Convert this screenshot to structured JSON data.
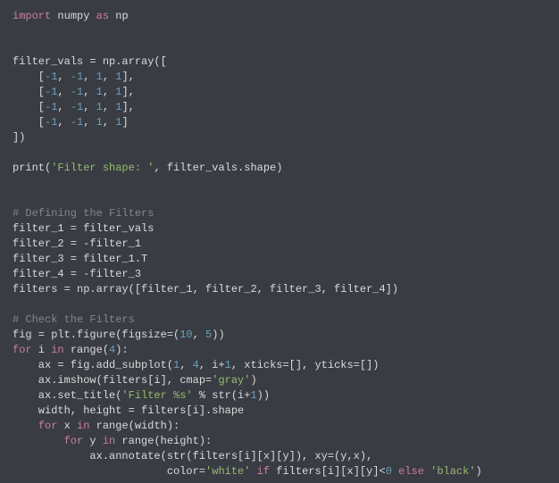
{
  "code": {
    "lines": [
      [
        {
          "t": "import",
          "c": "kw"
        },
        {
          "t": " numpy ",
          "c": "id"
        },
        {
          "t": "as",
          "c": "kw"
        },
        {
          "t": " np",
          "c": "id"
        }
      ],
      [],
      [],
      [
        {
          "t": "filter_vals = np.array([",
          "c": "id"
        }
      ],
      [
        {
          "t": "    [",
          "c": "id"
        },
        {
          "t": "-1",
          "c": "num"
        },
        {
          "t": ", ",
          "c": "id"
        },
        {
          "t": "-1",
          "c": "num"
        },
        {
          "t": ", ",
          "c": "id"
        },
        {
          "t": "1",
          "c": "num"
        },
        {
          "t": ", ",
          "c": "id"
        },
        {
          "t": "1",
          "c": "num"
        },
        {
          "t": "],",
          "c": "id"
        }
      ],
      [
        {
          "t": "    [",
          "c": "id"
        },
        {
          "t": "-1",
          "c": "num"
        },
        {
          "t": ", ",
          "c": "id"
        },
        {
          "t": "-1",
          "c": "num"
        },
        {
          "t": ", ",
          "c": "id"
        },
        {
          "t": "1",
          "c": "num"
        },
        {
          "t": ", ",
          "c": "id"
        },
        {
          "t": "1",
          "c": "num"
        },
        {
          "t": "],",
          "c": "id"
        }
      ],
      [
        {
          "t": "    [",
          "c": "id"
        },
        {
          "t": "-1",
          "c": "num"
        },
        {
          "t": ", ",
          "c": "id"
        },
        {
          "t": "-1",
          "c": "num"
        },
        {
          "t": ", ",
          "c": "id"
        },
        {
          "t": "1",
          "c": "num"
        },
        {
          "t": ", ",
          "c": "id"
        },
        {
          "t": "1",
          "c": "num"
        },
        {
          "t": "],",
          "c": "id"
        }
      ],
      [
        {
          "t": "    [",
          "c": "id"
        },
        {
          "t": "-1",
          "c": "num"
        },
        {
          "t": ", ",
          "c": "id"
        },
        {
          "t": "-1",
          "c": "num"
        },
        {
          "t": ", ",
          "c": "id"
        },
        {
          "t": "1",
          "c": "num"
        },
        {
          "t": ", ",
          "c": "id"
        },
        {
          "t": "1",
          "c": "num"
        },
        {
          "t": "]",
          "c": "id"
        }
      ],
      [
        {
          "t": "])",
          "c": "id"
        }
      ],
      [],
      [
        {
          "t": "print(",
          "c": "id"
        },
        {
          "t": "'Filter shape: '",
          "c": "str"
        },
        {
          "t": ", filter_vals.shape)",
          "c": "id"
        }
      ],
      [],
      [],
      [
        {
          "t": "# Defining the Filters",
          "c": "cmt"
        }
      ],
      [
        {
          "t": "filter_1 = filter_vals",
          "c": "id"
        }
      ],
      [
        {
          "t": "filter_2 = -filter_1",
          "c": "id"
        }
      ],
      [
        {
          "t": "filter_3 = filter_1.T",
          "c": "id"
        }
      ],
      [
        {
          "t": "filter_4 = -filter_3",
          "c": "id"
        }
      ],
      [
        {
          "t": "filters = np.array([filter_1, filter_2, filter_3, filter_4])",
          "c": "id"
        }
      ],
      [],
      [
        {
          "t": "# Check the Filters",
          "c": "cmt"
        }
      ],
      [
        {
          "t": "fig = plt.figure(figsize=(",
          "c": "id"
        },
        {
          "t": "10",
          "c": "num"
        },
        {
          "t": ", ",
          "c": "id"
        },
        {
          "t": "5",
          "c": "num"
        },
        {
          "t": "))",
          "c": "id"
        }
      ],
      [
        {
          "t": "for",
          "c": "kw"
        },
        {
          "t": " i ",
          "c": "id"
        },
        {
          "t": "in",
          "c": "kw"
        },
        {
          "t": " range(",
          "c": "id"
        },
        {
          "t": "4",
          "c": "num"
        },
        {
          "t": "):",
          "c": "id"
        }
      ],
      [
        {
          "t": "    ax = fig.add_subplot(",
          "c": "id"
        },
        {
          "t": "1",
          "c": "num"
        },
        {
          "t": ", ",
          "c": "id"
        },
        {
          "t": "4",
          "c": "num"
        },
        {
          "t": ", i+",
          "c": "id"
        },
        {
          "t": "1",
          "c": "num"
        },
        {
          "t": ", xticks=[], yticks=[])",
          "c": "id"
        }
      ],
      [
        {
          "t": "    ax.imshow(filters[i], cmap=",
          "c": "id"
        },
        {
          "t": "'gray'",
          "c": "str"
        },
        {
          "t": ")",
          "c": "id"
        }
      ],
      [
        {
          "t": "    ax.set_title(",
          "c": "id"
        },
        {
          "t": "'Filter %s'",
          "c": "str"
        },
        {
          "t": " % str(i+",
          "c": "id"
        },
        {
          "t": "1",
          "c": "num"
        },
        {
          "t": "))",
          "c": "id"
        }
      ],
      [
        {
          "t": "    width, height = filters[i].shape",
          "c": "id"
        }
      ],
      [
        {
          "t": "    ",
          "c": "id"
        },
        {
          "t": "for",
          "c": "kw"
        },
        {
          "t": " x ",
          "c": "id"
        },
        {
          "t": "in",
          "c": "kw"
        },
        {
          "t": " range(width):",
          "c": "id"
        }
      ],
      [
        {
          "t": "        ",
          "c": "id"
        },
        {
          "t": "for",
          "c": "kw"
        },
        {
          "t": " y ",
          "c": "id"
        },
        {
          "t": "in",
          "c": "kw"
        },
        {
          "t": " range(height):",
          "c": "id"
        }
      ],
      [
        {
          "t": "            ax.annotate(str(filters[i][x][y]), xy=(y,x),",
          "c": "id"
        }
      ],
      [
        {
          "t": "                        color=",
          "c": "id"
        },
        {
          "t": "'white'",
          "c": "str"
        },
        {
          "t": " ",
          "c": "id"
        },
        {
          "t": "if",
          "c": "kw"
        },
        {
          "t": " filters[i][x][y]<",
          "c": "id"
        },
        {
          "t": "0",
          "c": "num"
        },
        {
          "t": " ",
          "c": "id"
        },
        {
          "t": "else",
          "c": "kw"
        },
        {
          "t": " ",
          "c": "id"
        },
        {
          "t": "'black'",
          "c": "str"
        },
        {
          "t": ")",
          "c": "id"
        }
      ]
    ]
  }
}
